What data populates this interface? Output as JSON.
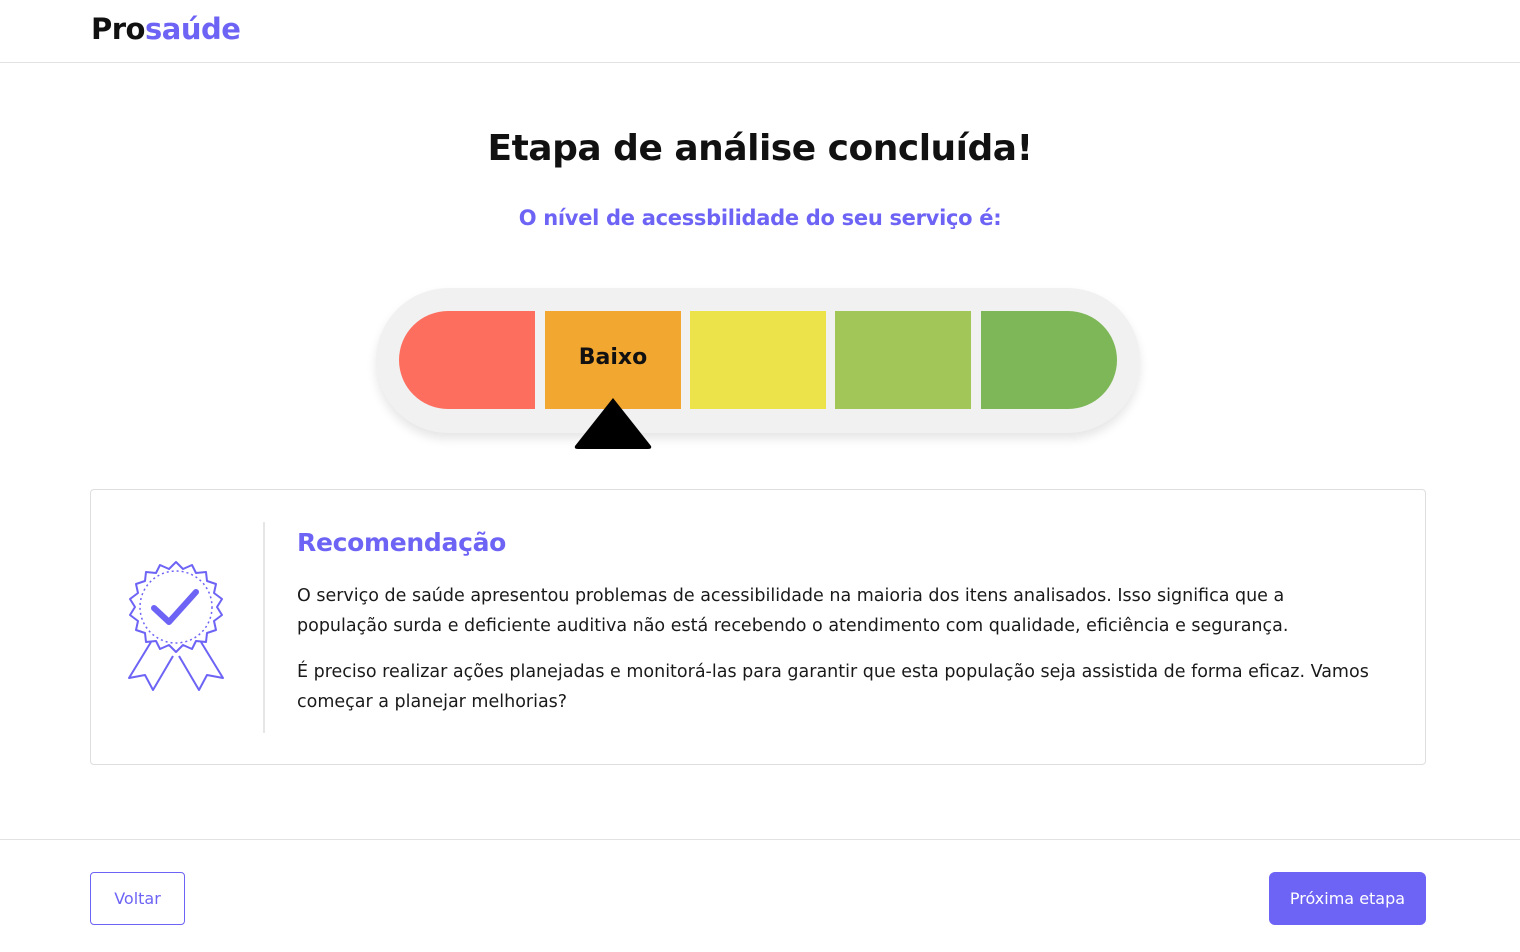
{
  "header": {
    "logo_part1": "Pro",
    "logo_part2": "saúde"
  },
  "main": {
    "title": "Etapa de análise concluída!",
    "subtitle": "O nível de acessbilidade do seu serviço é:"
  },
  "meter": {
    "segments": [
      {
        "color": "#fe6e5f"
      },
      {
        "color": "#f2a731"
      },
      {
        "color": "#ece34a"
      },
      {
        "color": "#a3c658"
      },
      {
        "color": "#7db757"
      }
    ],
    "selected_index": 2,
    "selected_label": "Baixo",
    "pointer_icon": "triangle-up-icon"
  },
  "recommendation": {
    "icon": "award-badge-check-icon",
    "title": "Recomendação",
    "paragraph1": "O serviço de saúde apresentou problemas de acessibilidade na maioria dos itens analisados. Isso significa que a população surda e deficiente auditiva não está recebendo o atendimento com qualidade, eficiência e segurança.",
    "paragraph2": "É preciso realizar ações planejadas e monitorá-las para garantir que esta população seja assistida de forma eficaz. Vamos começar a planejar melhorias?"
  },
  "footer": {
    "back_label": "Voltar",
    "next_label": "Próxima etapa"
  },
  "colors": {
    "accent": "#6d63f5",
    "text": "#111111"
  }
}
